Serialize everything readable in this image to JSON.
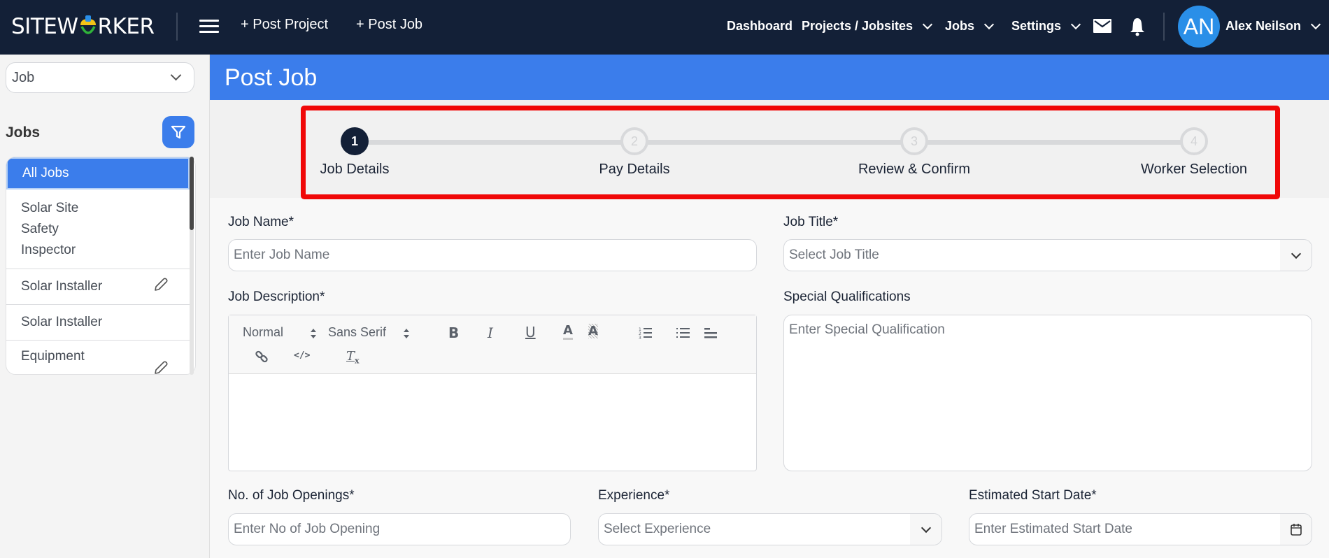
{
  "navbar": {
    "logo_text_left": "SITEW",
    "logo_text_right": "RKER",
    "links": {
      "post_project": "+ Post Project",
      "post_job": "+ Post Job"
    },
    "menu": {
      "dashboard": "Dashboard",
      "projects": "Projects / Jobsites",
      "jobs": "Jobs",
      "settings": "Settings"
    },
    "icons": [
      "menu-icon",
      "mail-icon",
      "bell-icon"
    ],
    "user": {
      "initials": "AN",
      "name": "Alex Neilson"
    }
  },
  "sidebar": {
    "type_select": "Job",
    "section_title": "Jobs",
    "items": [
      {
        "label": "All Jobs",
        "active": true,
        "editable": false
      },
      {
        "label_lines": [
          "Solar Site",
          "Safety",
          "Inspector"
        ],
        "active": false,
        "editable": false
      },
      {
        "label": "Solar Installer",
        "active": false,
        "editable": true
      },
      {
        "label": "Solar Installer",
        "active": false,
        "editable": false
      },
      {
        "label": "Equipment",
        "active": false,
        "editable": true
      }
    ]
  },
  "page": {
    "title": "Post Job"
  },
  "stepper": {
    "current_step": 1,
    "steps": [
      {
        "number": "1",
        "label": "Job Details"
      },
      {
        "number": "2",
        "label": "Pay Details"
      },
      {
        "number": "3",
        "label": "Review & Confirm"
      },
      {
        "number": "4",
        "label": "Worker Selection"
      }
    ],
    "highlight_color": "#f00808"
  },
  "form": {
    "job_name": {
      "label": "Job Name*",
      "placeholder": "Enter Job Name",
      "value": ""
    },
    "job_title": {
      "label": "Job Title*",
      "placeholder": "Select Job Title",
      "value": ""
    },
    "job_description": {
      "label": "Job Description*",
      "toolbar": {
        "heading": "Normal",
        "font": "Sans Serif"
      },
      "value": ""
    },
    "special_qualifications": {
      "label": "Special Qualifications",
      "placeholder": "Enter Special Qualification",
      "value": ""
    },
    "job_openings": {
      "label": "No. of Job Openings*",
      "placeholder": "Enter No of Job Opening",
      "value": ""
    },
    "experience": {
      "label": "Experience*",
      "placeholder": "Select Experience",
      "value": ""
    },
    "start_date": {
      "label": "Estimated Start Date*",
      "placeholder": "Enter Estimated Start Date",
      "value": ""
    }
  },
  "colors": {
    "navbar": "#132037",
    "accent": "#3b7deb",
    "step_active": "#132037",
    "step_inactive": "#d8d9db"
  }
}
